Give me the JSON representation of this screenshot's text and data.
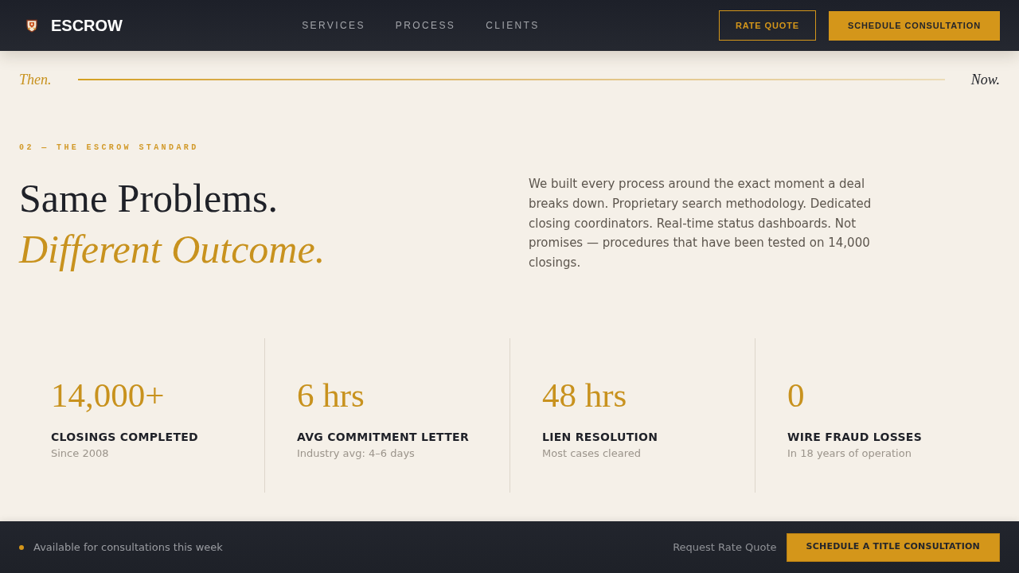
{
  "header": {
    "brand": "ESCROW",
    "nav": [
      {
        "label": "SERVICES"
      },
      {
        "label": "PROCESS"
      },
      {
        "label": "CLIENTS"
      }
    ],
    "actions": [
      {
        "label": "RATE QUOTE",
        "kind": "outline"
      },
      {
        "label": "SCHEDULE CONSULTATION",
        "kind": "filled"
      }
    ]
  },
  "timeline": {
    "start": "Then.",
    "end": "Now."
  },
  "section": {
    "eyebrow": "02 — THE ESCROW STANDARD",
    "heading": "Same Problems.",
    "heading_accent": "Different Outcome.",
    "body": "We built every process around the exact moment a deal breaks down. Proprietary search methodology. Dedicated closing coordinators. Real-time status dashboards. Not promises — procedures that have been tested on 14,000 closings."
  },
  "stats": [
    {
      "value": "14,000+",
      "label": "CLOSINGS COMPLETED",
      "note": "Since 2008"
    },
    {
      "value": "6 hrs",
      "label": "AVG COMMITMENT LETTER",
      "note": "Industry avg: 4–6 days"
    },
    {
      "value": "48 hrs",
      "label": "LIEN RESOLUTION",
      "note": "Most cases cleared"
    },
    {
      "value": "0",
      "label": "WIRE FRAUD LOSSES",
      "note": "In 18 years of operation"
    }
  ],
  "footer": {
    "status": "Available for consultations this week",
    "link": "Request Rate Quote",
    "button": "SCHEDULE A TITLE CONSULTATION"
  }
}
